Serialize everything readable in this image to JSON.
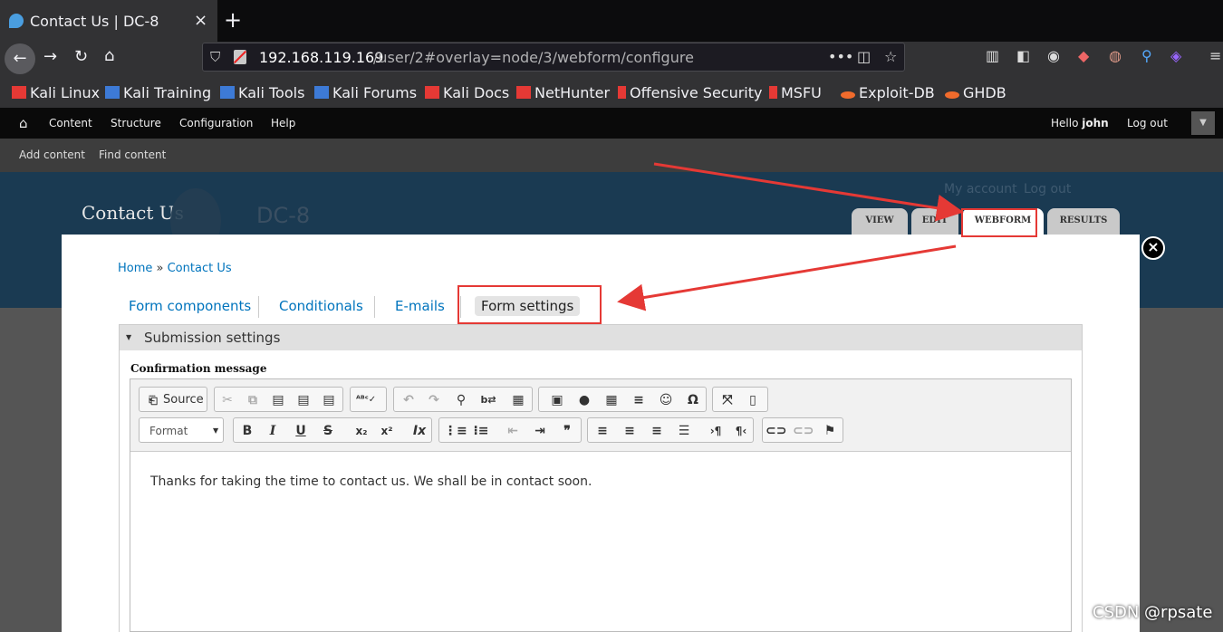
{
  "browser": {
    "tab_title": "Contact Us | DC-8",
    "tab_close": "×",
    "new_tab": "+",
    "url_host": "192.168.119.169",
    "url_path": "/user/2#overlay=node/3/webform/configure",
    "url_more": "•••"
  },
  "bookmarks": [
    {
      "label": "Kali Linux",
      "color": "#e53935"
    },
    {
      "label": "Kali Training",
      "color": "#3d7ad6"
    },
    {
      "label": "Kali Tools",
      "color": "#3d7ad6"
    },
    {
      "label": "Kali Forums",
      "color": "#3d7ad6"
    },
    {
      "label": "Kali Docs",
      "color": "#e53935"
    },
    {
      "label": "NetHunter",
      "color": "#e53935"
    },
    {
      "label": "Offensive Security",
      "color": "#e53935"
    },
    {
      "label": "MSFU",
      "color": "#e53935"
    },
    {
      "label": "Exploit-DB",
      "color": "#f06b2c"
    },
    {
      "label": "GHDB",
      "color": "#f06b2c"
    }
  ],
  "admin_menu": {
    "items": [
      "Content",
      "Structure",
      "Configuration",
      "Help"
    ],
    "hello": "Hello",
    "user": "john",
    "logout": "Log out"
  },
  "shortcuts": [
    "Add content",
    "Find content"
  ],
  "site": {
    "name": "Contact Us",
    "slogan": "DC-8",
    "secondary": [
      "My account",
      "Log out"
    ]
  },
  "page_tabs": [
    "VIEW",
    "EDIT",
    "WEBFORM",
    "RESULTS"
  ],
  "overlay": {
    "close": "×",
    "breadcrumb": {
      "home": "Home",
      "sep": " » ",
      "current": "Contact Us"
    },
    "webform_tabs": [
      "Form components",
      "Conditionals",
      "E-mails",
      "Form settings"
    ],
    "fieldset_legend": "Submission settings",
    "field_label": "Confirmation message",
    "source_label": "Source",
    "format_label": "Format",
    "editor_text": "Thanks for taking the time to contact us. We shall be in contact soon."
  },
  "watermark": "CSDN @rpsate",
  "colors": {
    "highlight": "#e53935",
    "link": "#0074bd"
  }
}
